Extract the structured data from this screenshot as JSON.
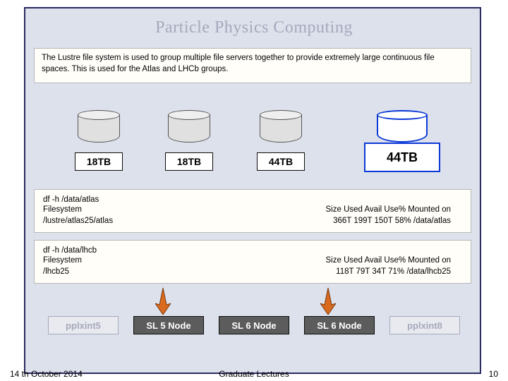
{
  "title": "Particle Physics Computing",
  "intro_text": "The Lustre file system is used to group multiple file servers together to provide extremely large continuous file spaces. This is used for the Atlas and LHCb groups.",
  "cylinders": [
    {
      "cap": "18TB"
    },
    {
      "cap": "18TB"
    },
    {
      "cap": "44TB"
    },
    {
      "cap": "44TB"
    }
  ],
  "df_atlas": {
    "cmd": "df -h /data/atlas",
    "hdr_label": "Filesystem",
    "hdr_cols": "Size  Used Avail Use% Mounted on",
    "path": "/lustre/atlas25/atlas",
    "values": "366T  199T  150T  58% /data/atlas"
  },
  "df_lhcb": {
    "cmd": "df -h /data/lhcb",
    "hdr_label": "Filesystem",
    "hdr_cols": "Size  Used Avail Use% Mounted on",
    "path": "/lhcb25",
    "values": "118T   79T   34T  71% /data/lhcb25"
  },
  "nodes": [
    {
      "label": "pplxint5",
      "variant": "ghost"
    },
    {
      "label": "SL 5 Node",
      "variant": "dark"
    },
    {
      "label": "SL 6 Node",
      "variant": "dark"
    },
    {
      "label": "SL 6 Node",
      "variant": "dark"
    },
    {
      "label": "pplxint8",
      "variant": "ghost"
    }
  ],
  "footer": {
    "date": "14 th October 2014",
    "center": "Graduate Lectures",
    "page": "10"
  },
  "colors": {
    "accent_blue": "#0d3ad6",
    "arrow": "#d96a1e",
    "slide_bg": "#dce1ec"
  }
}
